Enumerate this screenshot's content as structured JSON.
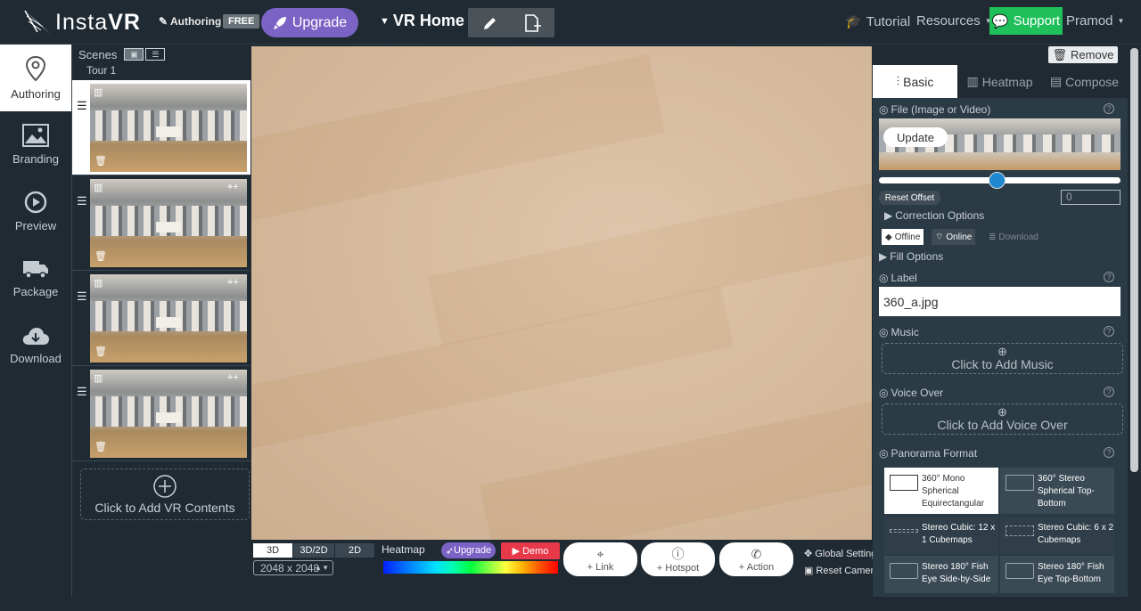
{
  "topbar": {
    "logo_insta": "Insta",
    "logo_vr": "VR",
    "mode": "Authoring",
    "badge": "FREE",
    "upgrade": "Upgrade",
    "project": "VR Home",
    "tutorial": "Tutorial",
    "resources": "Resources",
    "support": "Support",
    "user": "Pramod"
  },
  "nav": [
    "Authoring",
    "Branding",
    "Preview",
    "Package",
    "Download"
  ],
  "scenes": {
    "heading": "Scenes",
    "tour": "Tour 1",
    "add": "Click to Add VR Contents"
  },
  "bottom": {
    "modes": [
      "3D",
      "3D/2D",
      "2D"
    ],
    "resolution": "2048 x 2048",
    "heatmap": "Heatmap",
    "heat_upgrade": "Upgrade",
    "demo": "Demo",
    "link": "+ Link",
    "hotspot": "+ Hotspot",
    "action": "+ Action",
    "global": "Global Setting",
    "reset_camera": "Reset Camera"
  },
  "panel": {
    "remove": "Remove",
    "tabs": [
      "Basic",
      "Heatmap",
      "Compose"
    ],
    "file_label": "File (Image or Video)",
    "update": "Update",
    "reset_offset": "Reset Offset",
    "offset_value": "0",
    "offset_fraction": 0.49,
    "correction": "Correction Options",
    "offline": "Offline",
    "online": "Online",
    "download": "Download",
    "fill": "Fill Options",
    "label_title": "Label",
    "label_value": "360_a.jpg",
    "music_title": "Music",
    "music_add": "Click to Add Music",
    "voice_title": "Voice Over",
    "voice_add": "Click to Add Voice Over",
    "pano_title": "Panorama Format",
    "formats": [
      "360° Mono Spherical Equirectangular",
      "360° Stereo Spherical Top-Bottom",
      "Stereo Cubic: 12 x 1 Cubemaps",
      "Stereo Cubic: 6 x 2 Cubemaps",
      "Stereo 180° Fish Eye Side-by-Side",
      "Stereo 180° Fish Eye Top-Bottom"
    ]
  }
}
